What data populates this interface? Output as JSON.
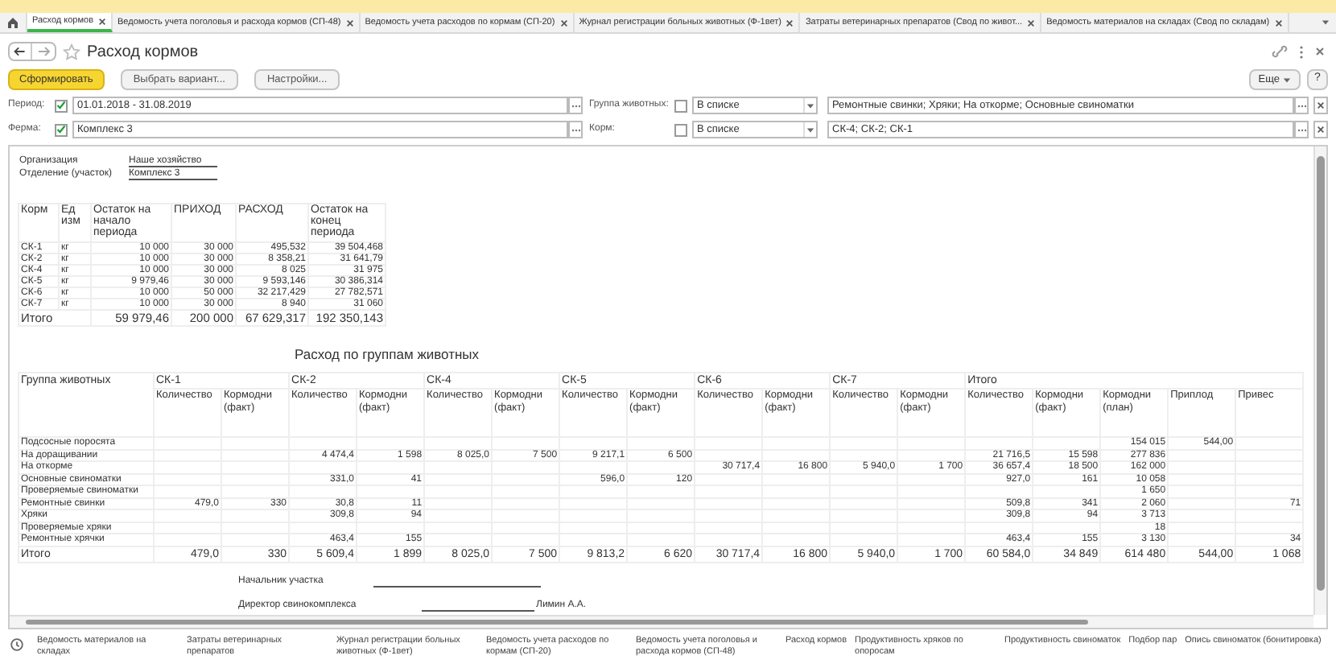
{
  "tabs": [
    {
      "label": "Расход кормов",
      "selected": true
    },
    {
      "label": "Ведомость учета поголовья и расхода кормов (СП-48)",
      "selected": false
    },
    {
      "label": "Ведомость учета расходов по кормам (СП-20)",
      "selected": false
    },
    {
      "label": "Журнал регистрации больных животных (Ф-1вет)",
      "selected": false
    },
    {
      "label": "Затраты ветеринарных препаратов (Свод по живот...",
      "selected": false
    },
    {
      "label": "Ведомость материалов на складах (Свод по складам)",
      "selected": false
    }
  ],
  "title": "Расход кормов",
  "toolbar": {
    "primary": "Сформировать",
    "buttons": [
      "Выбрать вариант...",
      "Настройки..."
    ],
    "more": "Еще",
    "help": "?"
  },
  "filters": [
    {
      "label": "Период:",
      "checked": true,
      "value": "01.01.2018 - 31.08.2019",
      "label2": "Группа животных:",
      "checked2": false,
      "condition": "В списке",
      "value2": "Ремонтные свинки; Хряки; На откорме; Основные свиноматки"
    },
    {
      "label": "Ферма:",
      "checked": true,
      "value": "Комплекс 3",
      "label2": "Корм:",
      "checked2": false,
      "condition": "В списке",
      "value2": "СК-4; СК-2; СК-1"
    }
  ],
  "report": {
    "header": [
      {
        "label": "Организация",
        "value": "Наше хозяйство"
      },
      {
        "label": "Отделение (участок)",
        "value": "Комплекс 3"
      }
    ],
    "stock_table": {
      "columns": [
        "Корм",
        "Ед изм",
        "Остаток на начало периода",
        "ПРИХОД",
        "РАСХОД",
        "Остаток на конец периода"
      ],
      "rows": [
        [
          "СК-1",
          "кг",
          "10 000",
          "30 000",
          "495,532",
          "39 504,468"
        ],
        [
          "СК-2",
          "кг",
          "10 000",
          "30 000",
          "8 358,21",
          "31 641,79"
        ],
        [
          "СК-4",
          "кг",
          "10 000",
          "30 000",
          "8 025",
          "31 975"
        ],
        [
          "СК-5",
          "кг",
          "9 979,46",
          "30 000",
          "9 593,146",
          "30 386,314"
        ],
        [
          "СК-6",
          "кг",
          "10 000",
          "50 000",
          "32 217,429",
          "27 782,571"
        ],
        [
          "СК-7",
          "кг",
          "10 000",
          "30 000",
          "8 940",
          "31 060"
        ]
      ],
      "total": [
        "Итого",
        "59 979,46",
        "200 000",
        "67 629,317",
        "192 350,143"
      ]
    },
    "group_title": "Расход по группам животных",
    "group_table": {
      "first_column": "Группа животных",
      "groups": [
        {
          "name": "СК-1",
          "columns": [
            "Количество",
            "Кормодни (факт)"
          ]
        },
        {
          "name": "СК-2",
          "columns": [
            "Количество",
            "Кормодни (факт)"
          ]
        },
        {
          "name": "СК-4",
          "columns": [
            "Количество",
            "Кормодни (факт)"
          ]
        },
        {
          "name": "СК-5",
          "columns": [
            "Количество",
            "Кормодни (факт)"
          ]
        },
        {
          "name": "СК-6",
          "columns": [
            "Количество",
            "Кормодни (факт)"
          ]
        },
        {
          "name": "СК-7",
          "columns": [
            "Количество",
            "Кормодни (факт)"
          ]
        },
        {
          "name": "Итого",
          "columns": [
            "Количество",
            "Кормодни (факт)",
            "Кормодни (план)",
            "Приплод",
            "Привес"
          ]
        }
      ],
      "rows": [
        {
          "label": "Подсосные поросята",
          "cells": [
            null,
            null,
            null,
            null,
            null,
            null,
            null,
            null,
            null,
            null,
            null,
            null,
            null,
            null,
            "154 015",
            "544,00",
            null
          ]
        },
        {
          "label": "На доращивании",
          "cells": [
            null,
            null,
            "4 474,4",
            "1 598",
            "8 025,0",
            "7 500",
            "9 217,1",
            "6 500",
            null,
            null,
            null,
            null,
            "21 716,5",
            "15 598",
            "277 836",
            null,
            null
          ]
        },
        {
          "label": "На откорме",
          "cells": [
            null,
            null,
            null,
            null,
            null,
            null,
            null,
            null,
            "30 717,4",
            "16 800",
            "5 940,0",
            "1 700",
            "36 657,4",
            "18 500",
            "162 000",
            null,
            null
          ]
        },
        {
          "label": "Основные свиноматки",
          "cells": [
            null,
            null,
            "331,0",
            "41",
            null,
            null,
            "596,0",
            "120",
            null,
            null,
            null,
            null,
            "927,0",
            "161",
            "10 058",
            null,
            null
          ]
        },
        {
          "label": "Проверяемые свиноматки",
          "cells": [
            null,
            null,
            null,
            null,
            null,
            null,
            null,
            null,
            null,
            null,
            null,
            null,
            null,
            null,
            "1 650",
            null,
            null
          ]
        },
        {
          "label": "Ремонтные свинки",
          "cells": [
            "479,0",
            "330",
            "30,8",
            "11",
            null,
            null,
            null,
            null,
            null,
            null,
            null,
            null,
            "509,8",
            "341",
            "2 060",
            null,
            "71"
          ]
        },
        {
          "label": "Хряки",
          "cells": [
            null,
            null,
            "309,8",
            "94",
            null,
            null,
            null,
            null,
            null,
            null,
            null,
            null,
            "309,8",
            "94",
            "3 713",
            null,
            null
          ]
        },
        {
          "label": "Проверяемые хряки",
          "cells": [
            null,
            null,
            null,
            null,
            null,
            null,
            null,
            null,
            null,
            null,
            null,
            null,
            null,
            null,
            "18",
            null,
            null
          ]
        },
        {
          "label": "Ремонтные хрячки",
          "cells": [
            null,
            null,
            "463,4",
            "155",
            null,
            null,
            null,
            null,
            null,
            null,
            null,
            null,
            "463,4",
            "155",
            "3 130",
            null,
            "34"
          ]
        }
      ],
      "total": {
        "label": "Итого",
        "cells": [
          "479,0",
          "330",
          "5 609,4",
          "1 899",
          "8 025,0",
          "7 500",
          "9 813,2",
          "6 620",
          "30 717,4",
          "16 800",
          "5 940,0",
          "1 700",
          "60 584,0",
          "34 849",
          "614 480",
          "544,00",
          "1 068"
        ]
      }
    },
    "signatures": [
      {
        "label": "Начальник участка"
      },
      {
        "label": "Директор свинокомплекса",
        "name": "Лимин А.А."
      }
    ]
  },
  "bottom_nav": [
    "Ведомость материалов на складах",
    "Затраты ветеринарных препаратов",
    "Журнал регистрации больных животных (Ф-1вет)",
    "Ведомость учета расходов по кормам (СП-20)",
    "Ведомость учета поголовья и расхода кормов (СП-48)",
    "Расход кормов",
    "Продуктивность хряков по опоросам",
    "Продуктивность свиноматок",
    "Подбор пар",
    "Опись свиноматок (бонитировка)"
  ]
}
